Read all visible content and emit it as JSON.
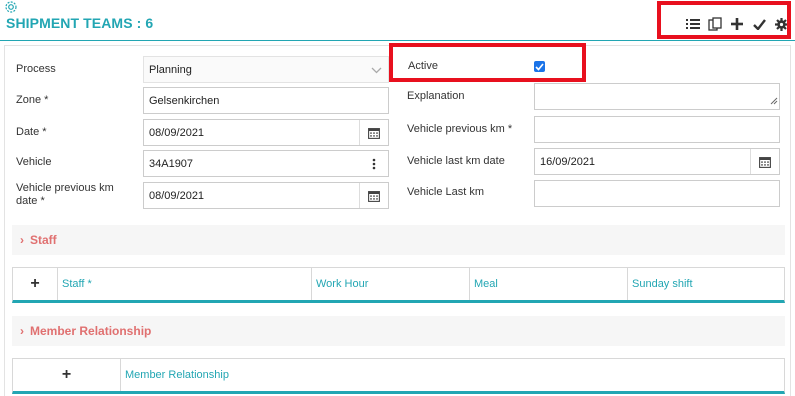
{
  "header": {
    "title": "SHIPMENT TEAMS : 6",
    "icons": [
      "gear-icon",
      "list-icon",
      "copy-icon",
      "plus-icon",
      "check-icon",
      "settings-icon"
    ]
  },
  "form": {
    "process": {
      "label": "Process",
      "value": "Planning"
    },
    "zone": {
      "label": "Zone *",
      "value": "Gelsenkirchen"
    },
    "date": {
      "label": "Date *",
      "value": "08/09/2021"
    },
    "vehicle": {
      "label": "Vehicle",
      "value": "34A1907"
    },
    "vehicle_prev_km_date": {
      "label_line1": "Vehicle previous km",
      "label_line2": "date *",
      "value": "08/09/2021"
    },
    "active": {
      "label": "Active",
      "checked": true
    },
    "explanation": {
      "label": "Explanation",
      "value": ""
    },
    "vehicle_prev_km": {
      "label": "Vehicle previous km *",
      "value": ""
    },
    "vehicle_last_km_date": {
      "label": "Vehicle last km date",
      "value": "16/09/2021"
    },
    "vehicle_last_km": {
      "label": "Vehicle Last km",
      "value": ""
    }
  },
  "staff_section": {
    "title": "Staff",
    "add_label": "+",
    "columns": [
      "Staff *",
      "Work Hour",
      "Meal",
      "Sunday shift"
    ]
  },
  "member_section": {
    "title": "Member Relationship",
    "add_label": "+",
    "columns": [
      "Member Relationship"
    ]
  },
  "colors": {
    "accent": "#22a6b3",
    "section_title": "#e07070",
    "highlight": "#e8101e",
    "checkbox": "#1a73e8"
  }
}
